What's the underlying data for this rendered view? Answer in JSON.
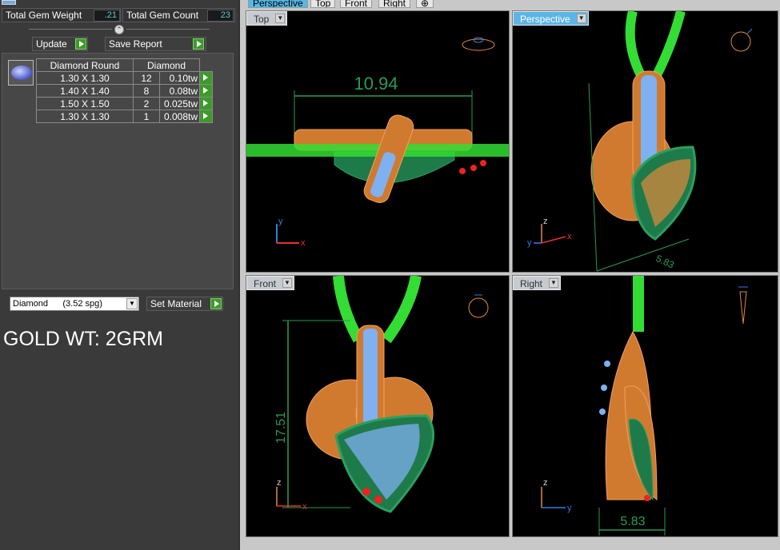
{
  "stats": {
    "total_weight_label": "Total Gem Weight",
    "total_weight_value": ".21",
    "total_count_label": "Total Gem Count",
    "total_count_value": "23"
  },
  "actions": {
    "update_label": "Update",
    "save_report_label": "Save Report",
    "set_material_label": "Set Material"
  },
  "gem_table": {
    "headers": [
      "Diamond Round",
      "Diamond"
    ],
    "rows": [
      {
        "size": "1.30 X 1.30",
        "count": "12",
        "weight": "0.10tw"
      },
      {
        "size": "1.40 X 1.40",
        "count": "8",
        "weight": "0.08tw"
      },
      {
        "size": "1.50 X 1.50",
        "count": "2",
        "weight": "0.025tw"
      },
      {
        "size": "1.30 X 1.30",
        "count": "1",
        "weight": "0.008tw"
      }
    ]
  },
  "material": {
    "selected": "Diamond      (3.52 spg)"
  },
  "gold_note": "GOLD WT: 2GRM",
  "tabs": [
    "Perspective",
    "Top",
    "Front",
    "Right"
  ],
  "viewports": {
    "top": {
      "label": "Top",
      "dimension": "10.94"
    },
    "perspective": {
      "label": "Perspective",
      "dimension": "5.83"
    },
    "front": {
      "label": "Front",
      "dimension": "17.51"
    },
    "right": {
      "label": "Right",
      "dimension": "5.83"
    }
  },
  "axes": {
    "x": "x",
    "y": "y",
    "z": "z"
  },
  "colors": {
    "accent": "#56b8e6",
    "gold_metal": "#e08a3c",
    "enamel": "#1f7a4a",
    "chain": "#33dd33",
    "diamond": "#7fb0f0",
    "ruby": "#ee2222",
    "dimension": "#2a9a55"
  }
}
